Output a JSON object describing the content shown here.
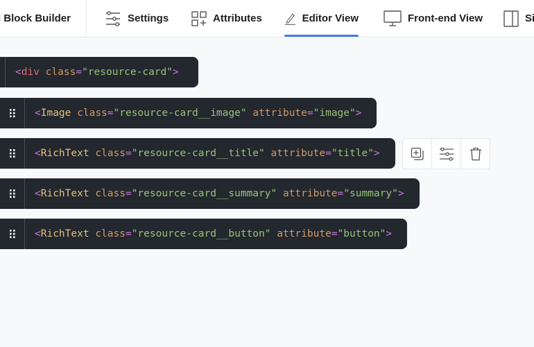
{
  "header": {
    "title": "d Block Builder",
    "tabs": [
      {
        "label": "Settings",
        "icon": "sliders-icon"
      },
      {
        "label": "Attributes",
        "icon": "attributes-grid-icon"
      },
      {
        "label": "Editor View",
        "icon": "pencil-icon",
        "active": true
      },
      {
        "label": "Front-end View",
        "icon": "monitor-icon"
      },
      {
        "label": "Si",
        "icon": "sidebar-icon"
      }
    ],
    "accent": "#3f7de8"
  },
  "rows": [
    {
      "tag": "div",
      "attrs": [
        {
          "name": "class",
          "value": "\"resource-card\""
        }
      ]
    },
    {
      "tag": "Image",
      "attrs": [
        {
          "name": "class",
          "value": "\"resource-card__image\""
        },
        {
          "name": "attribute",
          "value": "\"image\""
        }
      ]
    },
    {
      "tag": "RichText",
      "attrs": [
        {
          "name": "class",
          "value": "\"resource-card__title\""
        },
        {
          "name": "attribute",
          "value": "\"title\""
        }
      ]
    },
    {
      "tag": "RichText",
      "attrs": [
        {
          "name": "class",
          "value": "\"resource-card__summary\""
        },
        {
          "name": "attribute",
          "value": "\"summary\""
        }
      ]
    },
    {
      "tag": "RichText",
      "attrs": [
        {
          "name": "class",
          "value": "\"resource-card__button\""
        },
        {
          "name": "attribute",
          "value": "\"button\""
        }
      ]
    }
  ],
  "actions": [
    {
      "icon": "duplicate-icon"
    },
    {
      "icon": "settings-sliders-icon"
    },
    {
      "icon": "trash-icon"
    }
  ],
  "colors": {
    "code_bg": "#23272e",
    "bracket": "#c678dd",
    "tag": "#e5c07b",
    "attr": "#d19a66",
    "string": "#98c379"
  }
}
